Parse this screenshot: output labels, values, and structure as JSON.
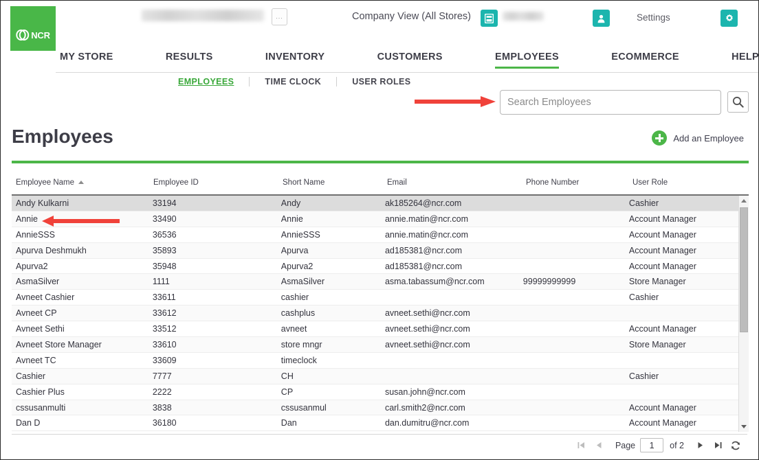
{
  "header": {
    "logo_text": "NCR",
    "company_view_label": "Company View (All Stores)",
    "settings_label": "Settings",
    "dots_label": "...",
    "store_name_redacted": "",
    "user_name_redacted": ""
  },
  "main_nav": [
    {
      "label": "MY STORE",
      "active": false
    },
    {
      "label": "RESULTS",
      "active": false
    },
    {
      "label": "INVENTORY",
      "active": false
    },
    {
      "label": "CUSTOMERS",
      "active": false
    },
    {
      "label": "EMPLOYEES",
      "active": true
    },
    {
      "label": "ECOMMERCE",
      "active": false
    },
    {
      "label": "HELP",
      "active": false
    }
  ],
  "sub_nav": [
    {
      "label": "EMPLOYEES",
      "active": true
    },
    {
      "label": "TIME CLOCK",
      "active": false
    },
    {
      "label": "USER ROLES",
      "active": false
    }
  ],
  "search": {
    "placeholder": "Search Employees",
    "value": ""
  },
  "page": {
    "title": "Employees",
    "add_button_label": "Add an Employee"
  },
  "table": {
    "columns": [
      "Employee Name",
      "Employee ID",
      "Short Name",
      "Email",
      "Phone Number",
      "User Role"
    ],
    "sort_column": "Employee Name",
    "sort_direction": "asc",
    "rows": [
      {
        "name": "Andy Kulkarni",
        "id": "33194",
        "short": "Andy",
        "email": "ak185264@ncr.com",
        "phone": "",
        "role": "Cashier"
      },
      {
        "name": "Annie",
        "id": "33490",
        "short": "Annie",
        "email": "annie.matin@ncr.com",
        "phone": "",
        "role": "Account Manager"
      },
      {
        "name": "AnnieSSS",
        "id": "36536",
        "short": "AnnieSSS",
        "email": "annie.matin@ncr.com",
        "phone": "",
        "role": "Account Manager"
      },
      {
        "name": "Apurva Deshmukh",
        "id": "35893",
        "short": "Apurva",
        "email": "ad185381@ncr.com",
        "phone": "",
        "role": "Account Manager"
      },
      {
        "name": "Apurva2",
        "id": "35948",
        "short": "Apurva2",
        "email": "ad185381@ncr.com",
        "phone": "",
        "role": "Account Manager"
      },
      {
        "name": "AsmaSilver",
        "id": "1111",
        "short": "AsmaSilver",
        "email": "asma.tabassum@ncr.com",
        "phone": "99999999999",
        "role": "Store Manager"
      },
      {
        "name": "Avneet Cashier",
        "id": "33611",
        "short": "cashier",
        "email": "",
        "phone": "",
        "role": "Cashier"
      },
      {
        "name": "Avneet CP",
        "id": "33612",
        "short": "cashplus",
        "email": "avneet.sethi@ncr.com",
        "phone": "",
        "role": ""
      },
      {
        "name": "Avneet Sethi",
        "id": "33512",
        "short": "avneet",
        "email": "avneet.sethi@ncr.com",
        "phone": "",
        "role": "Account Manager"
      },
      {
        "name": "Avneet Store Manager",
        "id": "33610",
        "short": "store mngr",
        "email": "avneet.sethi@ncr.com",
        "phone": "",
        "role": "Store Manager"
      },
      {
        "name": "Avneet TC",
        "id": "33609",
        "short": "timeclock",
        "email": "",
        "phone": "",
        "role": ""
      },
      {
        "name": "Cashier",
        "id": "7777",
        "short": "CH",
        "email": "",
        "phone": "",
        "role": "Cashier"
      },
      {
        "name": "Cashier Plus",
        "id": "2222",
        "short": "CP",
        "email": "susan.john@ncr.com",
        "phone": "",
        "role": ""
      },
      {
        "name": "cssusanmulti",
        "id": "3838",
        "short": "cssusanmul",
        "email": "carl.smith2@ncr.com",
        "phone": "",
        "role": "Account Manager"
      },
      {
        "name": "Dan D",
        "id": "36180",
        "short": "Dan",
        "email": "dan.dumitru@ncr.com",
        "phone": "",
        "role": "Account Manager"
      }
    ]
  },
  "pager": {
    "page_label": "Page",
    "page_value": "1",
    "of_label": "of 2"
  },
  "colors": {
    "brand_green": "#4cb648",
    "teal": "#1cb5ae",
    "annotation_red": "#f0423a",
    "text_dark": "#3d3d47"
  }
}
